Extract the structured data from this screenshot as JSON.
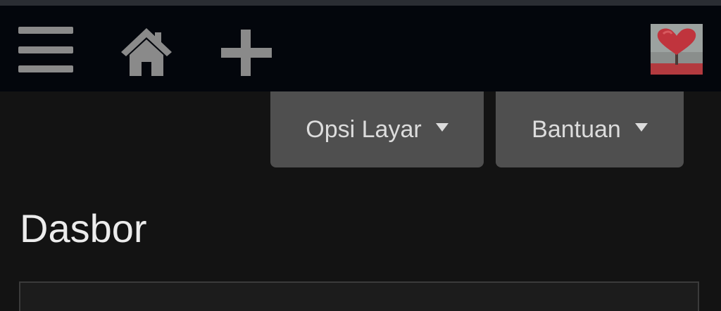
{
  "adminbar": {
    "icons": {
      "menu": "menu-icon",
      "home": "home-icon",
      "add": "plus-icon",
      "avatar": "heart-tree-avatar"
    },
    "colors": {
      "background": "#03060c",
      "icon": "#8a8a8a"
    }
  },
  "screen_meta": {
    "screen_options_label": "Opsi Layar",
    "help_label": "Bantuan",
    "tab_background": "#4f4f4f"
  },
  "page": {
    "title": "Dasbor",
    "background": "#131313"
  }
}
